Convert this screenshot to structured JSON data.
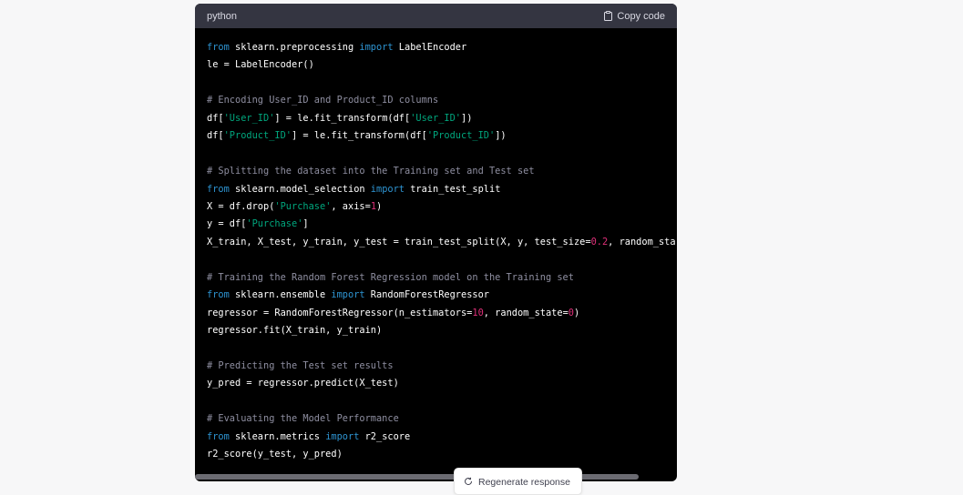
{
  "code_block": {
    "language": "python",
    "copy_label": "Copy code",
    "lines": [
      [
        {
          "t": "from",
          "c": "kw"
        },
        {
          "t": " sklearn.preprocessing "
        },
        {
          "t": "import",
          "c": "kw"
        },
        {
          "t": " LabelEncoder"
        }
      ],
      [
        {
          "t": "le = LabelEncoder()"
        }
      ],
      [],
      [
        {
          "t": "# Encoding User_ID and Product_ID columns",
          "c": "cm"
        }
      ],
      [
        {
          "t": "df["
        },
        {
          "t": "'User_ID'",
          "c": "str"
        },
        {
          "t": "] = le.fit_transform(df["
        },
        {
          "t": "'User_ID'",
          "c": "str"
        },
        {
          "t": "])"
        }
      ],
      [
        {
          "t": "df["
        },
        {
          "t": "'Product_ID'",
          "c": "str"
        },
        {
          "t": "] = le.fit_transform(df["
        },
        {
          "t": "'Product_ID'",
          "c": "str"
        },
        {
          "t": "])"
        }
      ],
      [],
      [
        {
          "t": "# Splitting the dataset into the Training set and Test set",
          "c": "cm"
        }
      ],
      [
        {
          "t": "from",
          "c": "kw"
        },
        {
          "t": " sklearn.model_selection "
        },
        {
          "t": "import",
          "c": "kw"
        },
        {
          "t": " train_test_split"
        }
      ],
      [
        {
          "t": "X = df.drop("
        },
        {
          "t": "'Purchase'",
          "c": "str"
        },
        {
          "t": ", axis="
        },
        {
          "t": "1",
          "c": "num"
        },
        {
          "t": ")"
        }
      ],
      [
        {
          "t": "y = df["
        },
        {
          "t": "'Purchase'",
          "c": "str"
        },
        {
          "t": "]"
        }
      ],
      [
        {
          "t": "X_train, X_test, y_train, y_test = train_test_split(X, y, test_size="
        },
        {
          "t": "0.2",
          "c": "num"
        },
        {
          "t": ", random_sta"
        }
      ],
      [],
      [
        {
          "t": "# Training the Random Forest Regression model on the Training set",
          "c": "cm"
        }
      ],
      [
        {
          "t": "from",
          "c": "kw"
        },
        {
          "t": " sklearn.ensemble "
        },
        {
          "t": "import",
          "c": "kw"
        },
        {
          "t": " RandomForestRegressor"
        }
      ],
      [
        {
          "t": "regressor = RandomForestRegressor(n_estimators="
        },
        {
          "t": "10",
          "c": "num"
        },
        {
          "t": ", random_state="
        },
        {
          "t": "0",
          "c": "num"
        },
        {
          "t": ")"
        }
      ],
      [
        {
          "t": "regressor.fit(X_train, y_train)"
        }
      ],
      [],
      [
        {
          "t": "# Predicting the Test set results",
          "c": "cm"
        }
      ],
      [
        {
          "t": "y_pred = regressor.predict(X_test)"
        }
      ],
      [],
      [
        {
          "t": "# Evaluating the Model Performance",
          "c": "cm"
        }
      ],
      [
        {
          "t": "from",
          "c": "kw"
        },
        {
          "t": " sklearn.metrics "
        },
        {
          "t": "import",
          "c": "kw"
        },
        {
          "t": " r2_score"
        }
      ],
      [
        {
          "t": "r2_score(y_test, y_pred)"
        }
      ]
    ]
  },
  "regenerate_label": "Regenerate response",
  "icons": {
    "copy": "clipboard-icon",
    "regenerate": "refresh-icon"
  },
  "colors": {
    "keyword": "#2e95d3",
    "string": "#00a67d",
    "number": "#df3079",
    "comment": "#8e8ea0"
  }
}
